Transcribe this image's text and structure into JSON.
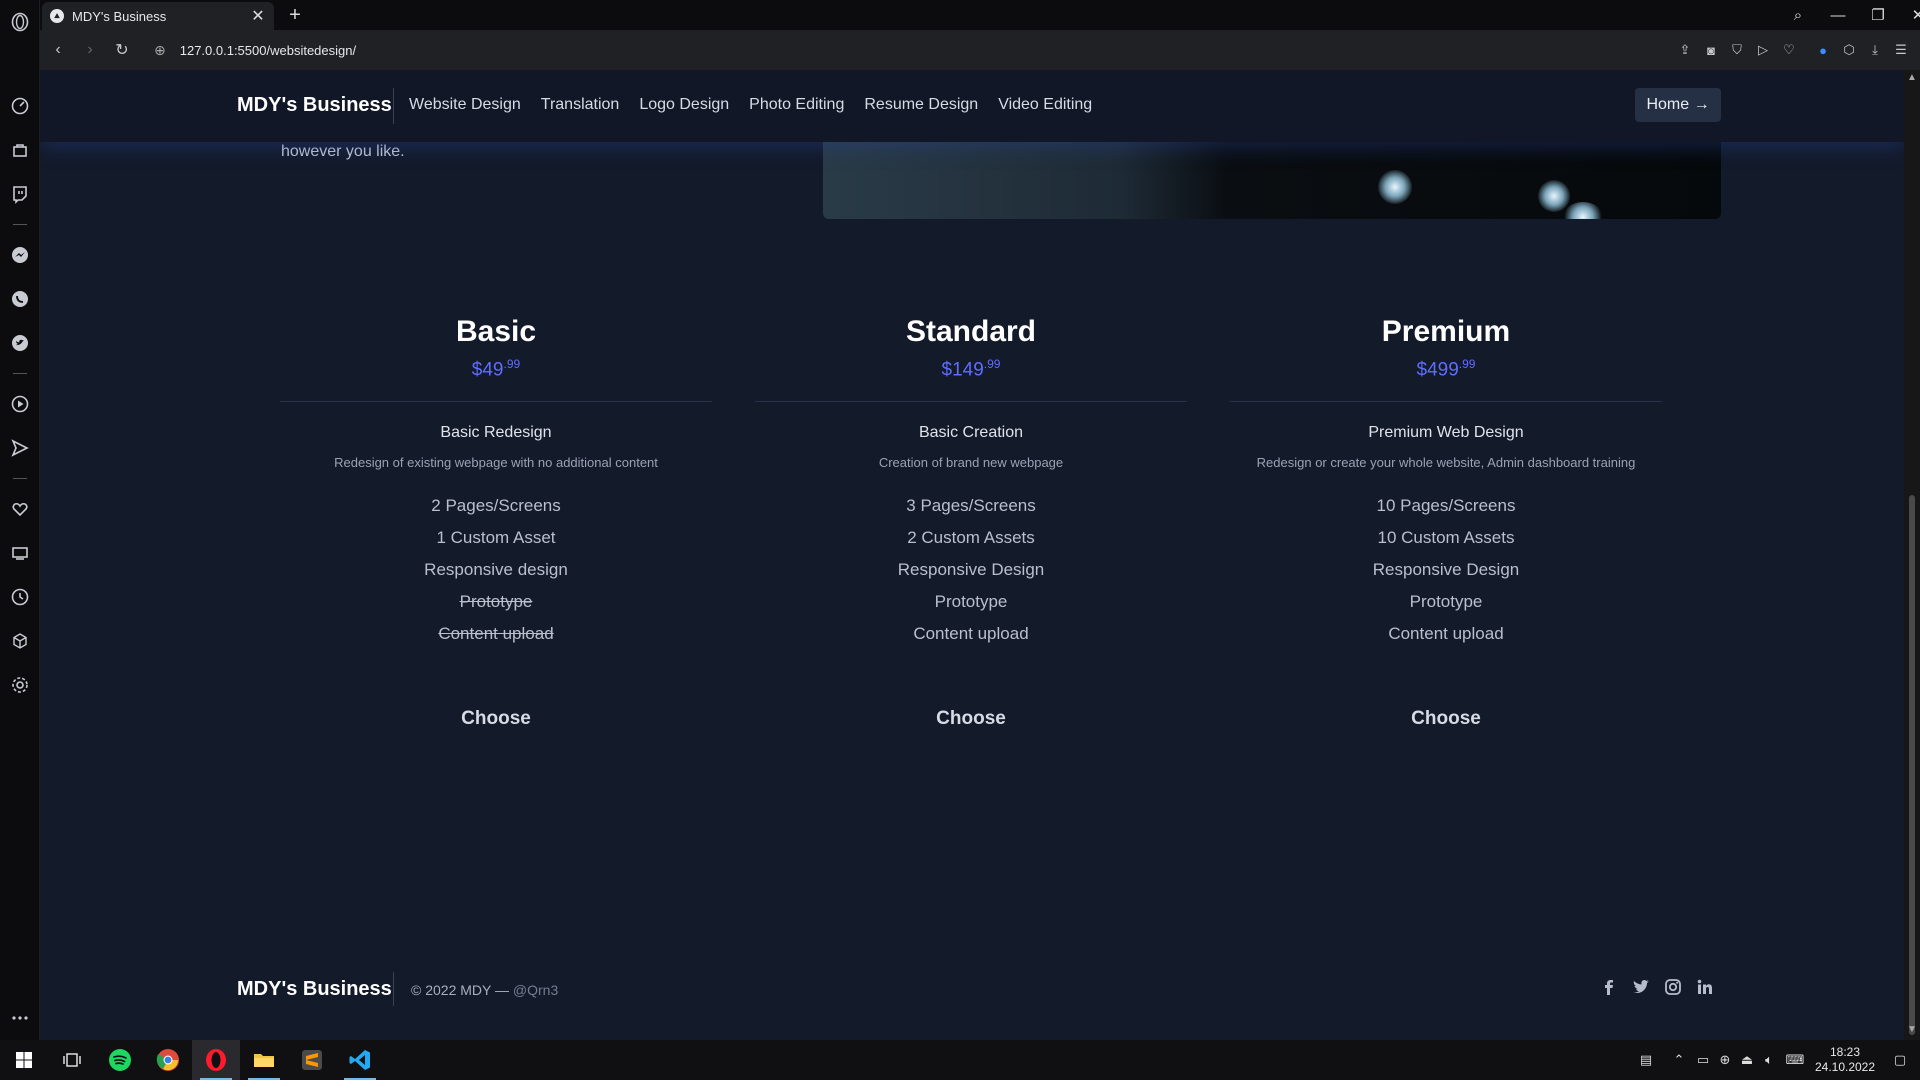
{
  "browser": {
    "tab_title": "MDY's Business",
    "tab_close": "✕",
    "new_tab": "+",
    "url": "127.0.0.1:5500/websitedesign/"
  },
  "site": {
    "brand": "MDY's Business",
    "nav": [
      "Website Design",
      "Translation",
      "Logo Design",
      "Photo Editing",
      "Resume Design",
      "Video Editing"
    ],
    "home_button": "Home →",
    "hero_text": "however you like."
  },
  "plans": [
    {
      "name": "Basic",
      "price_main": "$49",
      "price_cents": ".99",
      "title": "Basic Redesign",
      "description": "Redesign of existing webpage with no additional content",
      "features": [
        {
          "label": "2 Pages/Screens",
          "included": true
        },
        {
          "label": "1 Custom Asset",
          "included": true
        },
        {
          "label": "Responsive design",
          "included": true
        },
        {
          "label": "Prototype",
          "included": false
        },
        {
          "label": "Content upload",
          "included": false
        }
      ],
      "cta": "Choose"
    },
    {
      "name": "Standard",
      "price_main": "$149",
      "price_cents": ".99",
      "title": "Basic Creation",
      "description": "Creation of brand new webpage",
      "features": [
        {
          "label": "3 Pages/Screens",
          "included": true
        },
        {
          "label": "2 Custom Assets",
          "included": true
        },
        {
          "label": "Responsive Design",
          "included": true
        },
        {
          "label": "Prototype",
          "included": true
        },
        {
          "label": "Content upload",
          "included": true
        }
      ],
      "cta": "Choose"
    },
    {
      "name": "Premium",
      "price_main": "$499",
      "price_cents": ".99",
      "title": "Premium Web Design",
      "description": "Redesign or create your whole website, Admin dashboard training",
      "features": [
        {
          "label": "10 Pages/Screens",
          "included": true
        },
        {
          "label": "10 Custom Assets",
          "included": true
        },
        {
          "label": "Responsive Design",
          "included": true
        },
        {
          "label": "Prototype",
          "included": true
        },
        {
          "label": "Content upload",
          "included": true
        }
      ],
      "cta": "Choose"
    }
  ],
  "footer": {
    "brand": "MDY's Business",
    "copyright": "© 2022 MDY —",
    "handle": "@Qrn3"
  },
  "taskbar": {
    "time": "18:23",
    "date": "24.10.2022"
  },
  "colors": {
    "accent_price": "#5f6dff",
    "page_bg": "#131a2a"
  }
}
